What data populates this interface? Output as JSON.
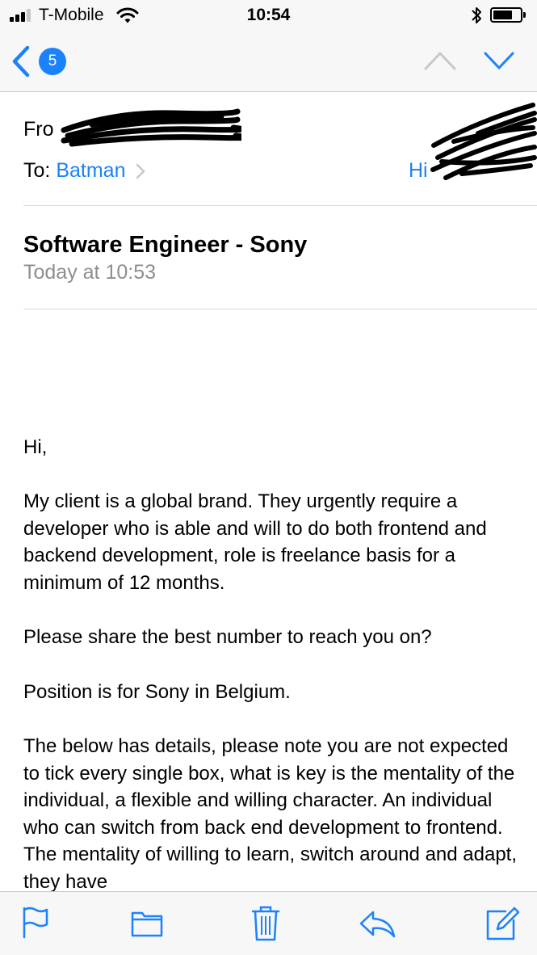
{
  "status_bar": {
    "carrier": "T-Mobile",
    "time": "10:54",
    "battery_level": 0.65,
    "icons": [
      "signal-icon",
      "wifi-icon",
      "bluetooth-icon",
      "battery-icon"
    ]
  },
  "nav": {
    "unread_count": "5",
    "icons": [
      "back-chevron-icon",
      "chevron-up-icon",
      "chevron-down-icon"
    ]
  },
  "header": {
    "from_label": "Fro",
    "to_label": "To:",
    "recipient": "Batman",
    "hide_label": "Hi"
  },
  "message": {
    "subject": "Software Engineer - Sony",
    "date": "Today at 10:53",
    "paragraphs": [
      "Hi,",
      "My client is a global brand. They urgently require a developer who is able and will to do both frontend and backend development, role is freelance basis for a minimum of 12 months.",
      "Please share the best number to reach you on?",
      "Position is for Sony in Belgium.",
      "The below has details, please note you are not expected to tick every single box, what is key is the mentality of the individual, a flexible and willing character. An individual who can switch from back end development to frontend. The mentality of willing to learn, switch around and adapt, they have"
    ]
  },
  "toolbar": {
    "icons": [
      "flag-icon",
      "folder-icon",
      "trash-icon",
      "reply-icon",
      "compose-icon"
    ]
  },
  "colors": {
    "accent": "#1a82fb",
    "bar_background": "#f7f7f7",
    "secondary_text": "#8e8e93"
  }
}
